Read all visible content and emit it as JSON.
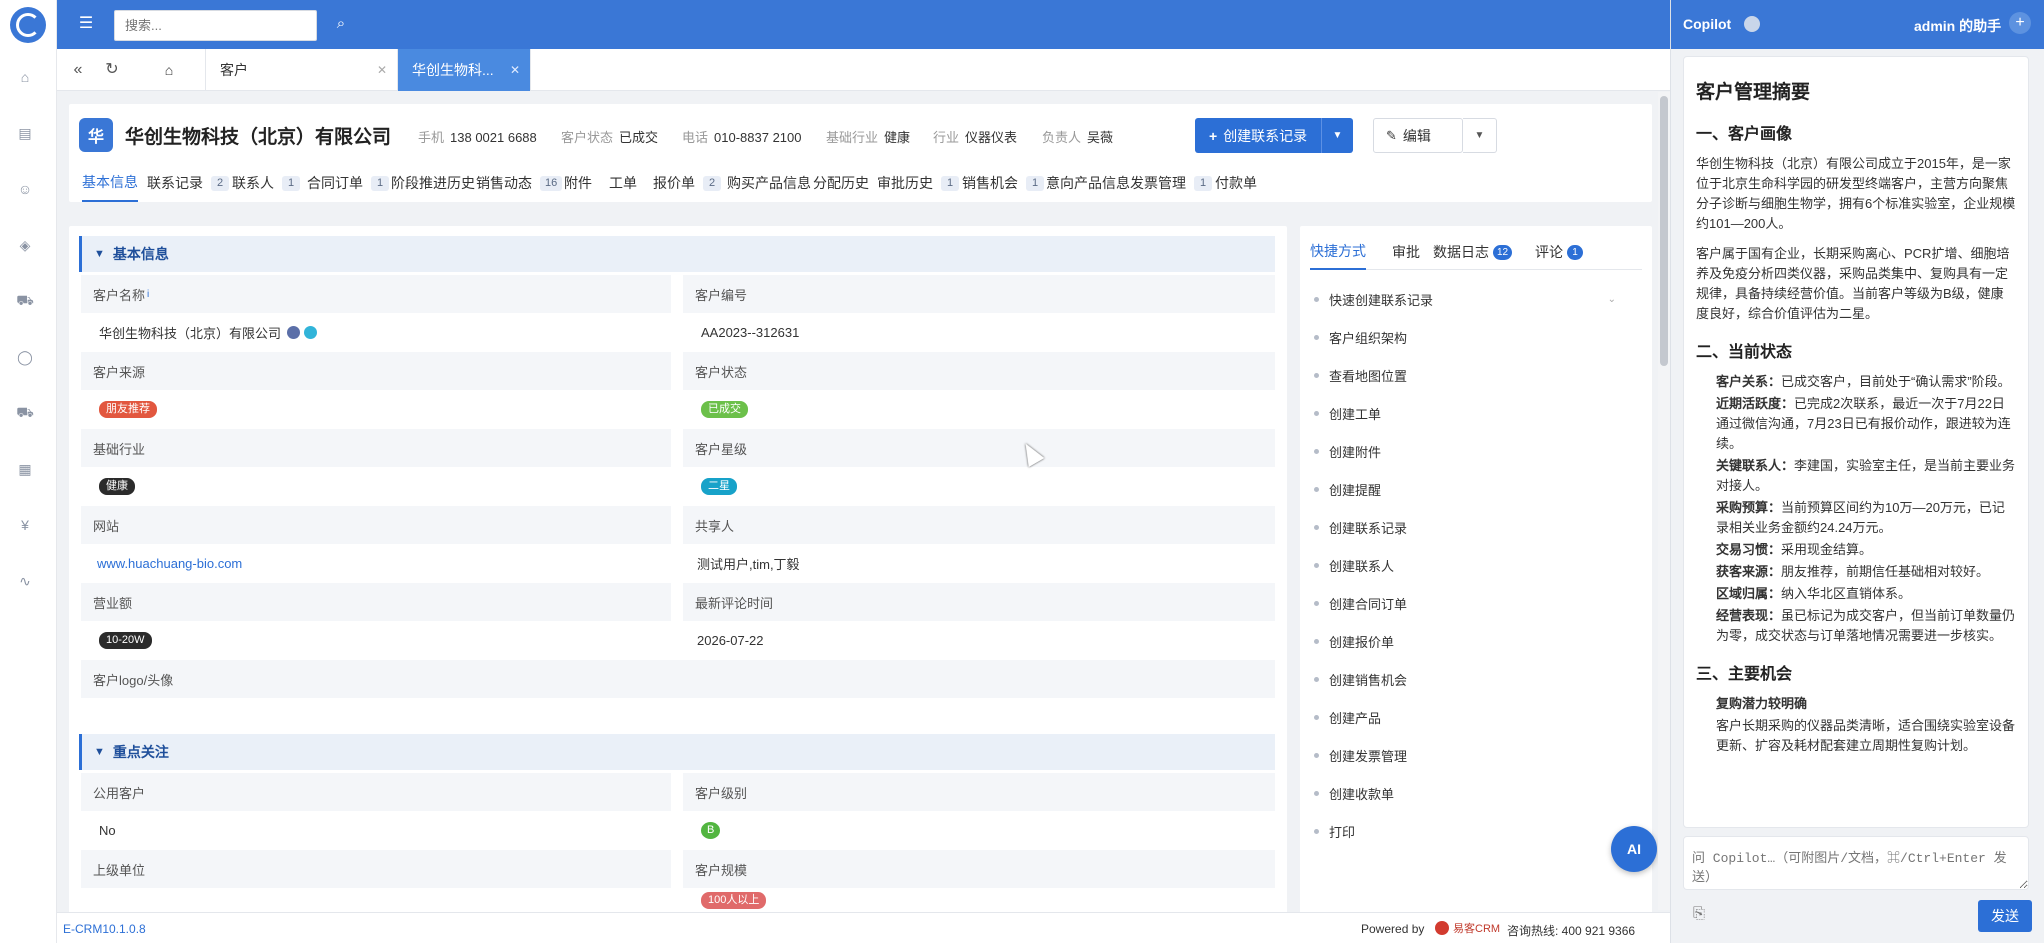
{
  "topbar": {
    "search_placeholder": "搜索..."
  },
  "tabs": [
    {
      "label": "客户"
    },
    {
      "label": "华创生物科..."
    }
  ],
  "header": {
    "avatar_text": "华",
    "company_name": "华创生物科技（北京）有限公司",
    "meta": [
      {
        "label": "手机",
        "value": "138 0021 6688"
      },
      {
        "label": "客户状态",
        "value": "已成交"
      },
      {
        "label": "电话",
        "value": "010-8837 2100"
      },
      {
        "label": "基础行业",
        "value": "健康"
      },
      {
        "label": "行业",
        "value": "仪器仪表"
      },
      {
        "label": "负责人",
        "value": "吴薇"
      }
    ],
    "create_button": "创建联系记录",
    "edit_button": "编辑"
  },
  "subtabs": [
    {
      "label": "基本信息",
      "badge": ""
    },
    {
      "label": "联系记录",
      "badge": "2"
    },
    {
      "label": "联系人",
      "badge": "1"
    },
    {
      "label": "合同订单",
      "badge": "1"
    },
    {
      "label": "阶段推进历史",
      "badge": ""
    },
    {
      "label": "销售动态",
      "badge": "16"
    },
    {
      "label": "附件",
      "badge": ""
    },
    {
      "label": "工单",
      "badge": ""
    },
    {
      "label": "报价单",
      "badge": "2"
    },
    {
      "label": "购买产品信息",
      "badge": ""
    },
    {
      "label": "分配历史",
      "badge": ""
    },
    {
      "label": "审批历史",
      "badge": "1"
    },
    {
      "label": "销售机会",
      "badge": "1"
    },
    {
      "label": "意向产品信息",
      "badge": ""
    },
    {
      "label": "发票管理",
      "badge": "1"
    },
    {
      "label": "付款单",
      "badge": ""
    }
  ],
  "basic": {
    "section_title": "基本信息",
    "customer_name_label": "客户名称",
    "customer_name_info": "i",
    "customer_name_value": "华创生物科技（北京）有限公司",
    "customer_no_label": "客户编号",
    "customer_no_value": "AA2023--312631",
    "source_label": "客户来源",
    "source_value": "朋友推荐",
    "status_label": "客户状态",
    "status_value": "已成交",
    "industry_label": "基础行业",
    "industry_value": "健康",
    "star_label": "客户星级",
    "star_value": "二星",
    "website_label": "网站",
    "website_value": "www.huachuang-bio.com",
    "sharer_label": "共享人",
    "sharer_value": "测试用户,tim,丁毅",
    "revenue_label": "营业额",
    "revenue_value": "10-20W",
    "last_comment_label": "最新评论时间",
    "last_comment_value": "2026-07-22",
    "logo_label": "客户logo/头像"
  },
  "focus": {
    "section_title": "重点关注",
    "public_label": "公用客户",
    "public_value": "No",
    "level_label": "客户级别",
    "level_value": "B",
    "parent_label": "上级单位",
    "scale_label": "客户规模",
    "scale_value": "100人以上"
  },
  "quick": {
    "tabs": [
      {
        "label": "快捷方式",
        "badge": ""
      },
      {
        "label": "审批",
        "badge": ""
      },
      {
        "label": "数据日志",
        "badge": "12"
      },
      {
        "label": "评论",
        "badge": "1"
      }
    ],
    "items": [
      "快速创建联系记录",
      "客户组织架构",
      "查看地图位置",
      "创建工单",
      "创建附件",
      "创建提醒",
      "创建联系记录",
      "创建联系人",
      "创建合同订单",
      "创建报价单",
      "创建销售机会",
      "创建产品",
      "创建发票管理",
      "创建收款单",
      "打印"
    ],
    "ai_label": "AI"
  },
  "footer": {
    "version": "E-CRM10.1.0.8",
    "powered_by": "Powered by",
    "brand": "易客CRM",
    "hotline": "咨询热线: 400 921 9366"
  },
  "copilot": {
    "title": "Copilot",
    "assistant": "admin 的助手",
    "summary_title": "客户管理摘要",
    "s1_title": "一、客户画像",
    "s1_p1": "华创生物科技（北京）有限公司成立于2015年，是一家位于北京生命科学园的研发型终端客户，主营方向聚焦分子诊断与细胞生物学，拥有6个标准实验室，企业规模约101—200人。",
    "s1_p2": "客户属于国有企业，长期采购离心、PCR扩增、细胞培养及免疫分析四类仪器，采购品类集中、复购具有一定规律，具备持续经营价值。当前客户等级为B级，健康度良好，综合价值评估为二星。",
    "s2_title": "二、当前状态",
    "s2_items": [
      {
        "label": "客户关系：",
        "text": "已成交客户，目前处于“确认需求”阶段。"
      },
      {
        "label": "近期活跃度：",
        "text": "已完成2次联系，最近一次于7月22日通过微信沟通，7月23日已有报价动作，跟进较为连续。"
      },
      {
        "label": "关键联系人：",
        "text": "李建国，实验室主任，是当前主要业务对接人。"
      },
      {
        "label": "采购预算：",
        "text": "当前预算区间约为10万—20万元，已记录相关业务金额约24.24万元。"
      },
      {
        "label": "交易习惯：",
        "text": "采用现金结算。"
      },
      {
        "label": "获客来源：",
        "text": "朋友推荐，前期信任基础相对较好。"
      },
      {
        "label": "区域归属：",
        "text": "纳入华北区直销体系。"
      },
      {
        "label": "经营表现：",
        "text": "虽已标记为成交客户，但当前订单数量仍为零，成交状态与订单落地情况需要进一步核实。"
      }
    ],
    "s3_title": "三、主要机会",
    "s3_sub": "复购潜力较明确",
    "s3_text": "客户长期采购的仪器品类清晰，适合围绕实验室设备更新、扩容及耗材配套建立周期性复购计划。",
    "input_placeholder": "问 Copilot…（可附图片/文档，⌘/Ctrl+Enter 发送）",
    "send_label": "发送"
  },
  "colors": {
    "primary": "#3a77d6",
    "button": "#2c6fd6",
    "tag_source": "#e2573f",
    "tag_status": "#6cc04a",
    "tag_industry": "#2b2b2b",
    "tag_star": "#17a2c9",
    "tag_revenue": "#2b2b2b",
    "tag_level": "#52b540",
    "tag_scale": "#e06a6a"
  }
}
